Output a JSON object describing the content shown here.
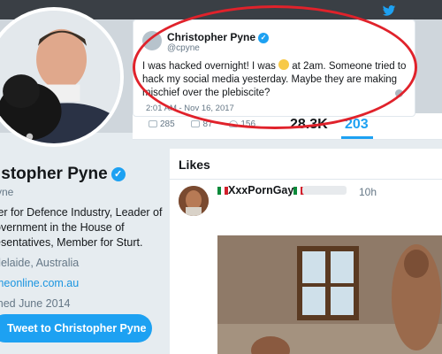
{
  "tweet_card": {
    "name": "Christopher Pyne",
    "handle": "@cpyne",
    "text_part1": "I was hacked overnight! I was",
    "text_part2": "at 2am. Someone tried to hack my social media yesterday. Maybe they are making mischief over the plebiscite?",
    "date": "2:01 AM - Nov 16, 2017",
    "replies": "285",
    "retweets": "87",
    "likes": "156"
  },
  "stats": {
    "following": "156",
    "followers": "28.3K",
    "likes": "203"
  },
  "profile": {
    "name": "istopher Pyne",
    "handle": "yne",
    "bio": "ter for Defence Industry, Leader of overnment in the House of esentatives, Member for Sturt.",
    "location": "delaide, Australia",
    "url": "meonline.com.au",
    "joined": "ined June 2014",
    "tweet_to_label": "Tweet to Christopher Pyne"
  },
  "likes_panel": {
    "heading": "Likes",
    "liked_name": "XxxPornGay",
    "liked_time": "10h"
  },
  "colors": {
    "twitter_blue": "#1da1f2",
    "highlight_red": "#e0222b"
  },
  "icons": [
    "twitter-bird-icon",
    "verified-icon",
    "reply-icon",
    "retweet-icon",
    "like-icon",
    "info-icon",
    "mexican-flag-icon"
  ]
}
